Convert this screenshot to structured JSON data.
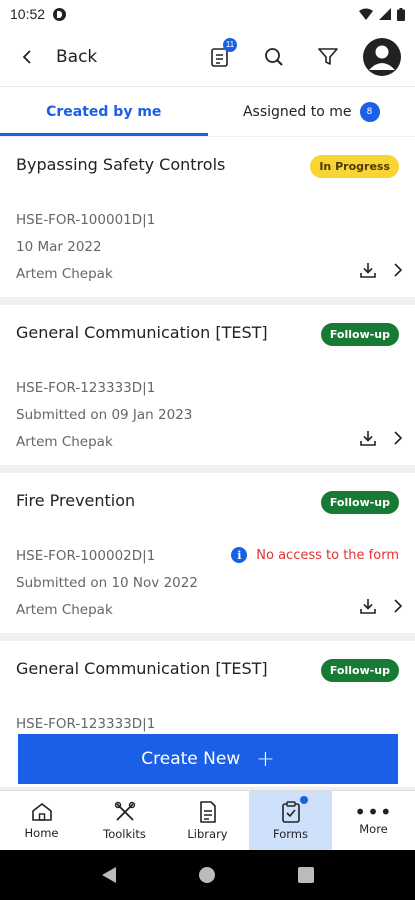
{
  "status_bar": {
    "time": "10:52"
  },
  "header": {
    "back_label": "Back",
    "forms_badge": "11"
  },
  "tabs": [
    {
      "label": "Created by me",
      "active": true
    },
    {
      "label": "Assigned to me",
      "count": "8",
      "active": false
    }
  ],
  "cards": [
    {
      "title": "Bypassing Safety Controls",
      "status": "In Progress",
      "code": "HSE-FOR-100001D|1",
      "date": "10 Mar 2022",
      "author": "Artem Chepak"
    },
    {
      "title": "General Communication [TEST]",
      "status": "Follow-up",
      "code": "HSE-FOR-123333D|1",
      "date": "Submitted on 09 Jan 2023",
      "author": "Artem Chepak"
    },
    {
      "title": "Fire Prevention",
      "status": "Follow-up",
      "code": "HSE-FOR-100002D|1",
      "date": "Submitted on 10 Nov 2022",
      "author": "Artem Chepak",
      "warning": "No access to the form"
    },
    {
      "title": "General Communication [TEST]",
      "status": "Follow-up",
      "code": "HSE-FOR-123333D|1"
    }
  ],
  "create_button": {
    "label": "Create New",
    "icon": "plus-icon"
  },
  "bottom_nav": [
    {
      "label": "Home",
      "icon": "home-icon"
    },
    {
      "label": "Toolkits",
      "icon": "toolkits-icon"
    },
    {
      "label": "Library",
      "icon": "library-icon"
    },
    {
      "label": "Forms",
      "icon": "forms-icon",
      "active": true
    },
    {
      "label": "More",
      "icon": "more-icon"
    }
  ],
  "colors": {
    "accent": "#1a5fe6",
    "in_progress": "#f9d435",
    "follow_up": "#177a35",
    "warning": "#e3322f"
  }
}
